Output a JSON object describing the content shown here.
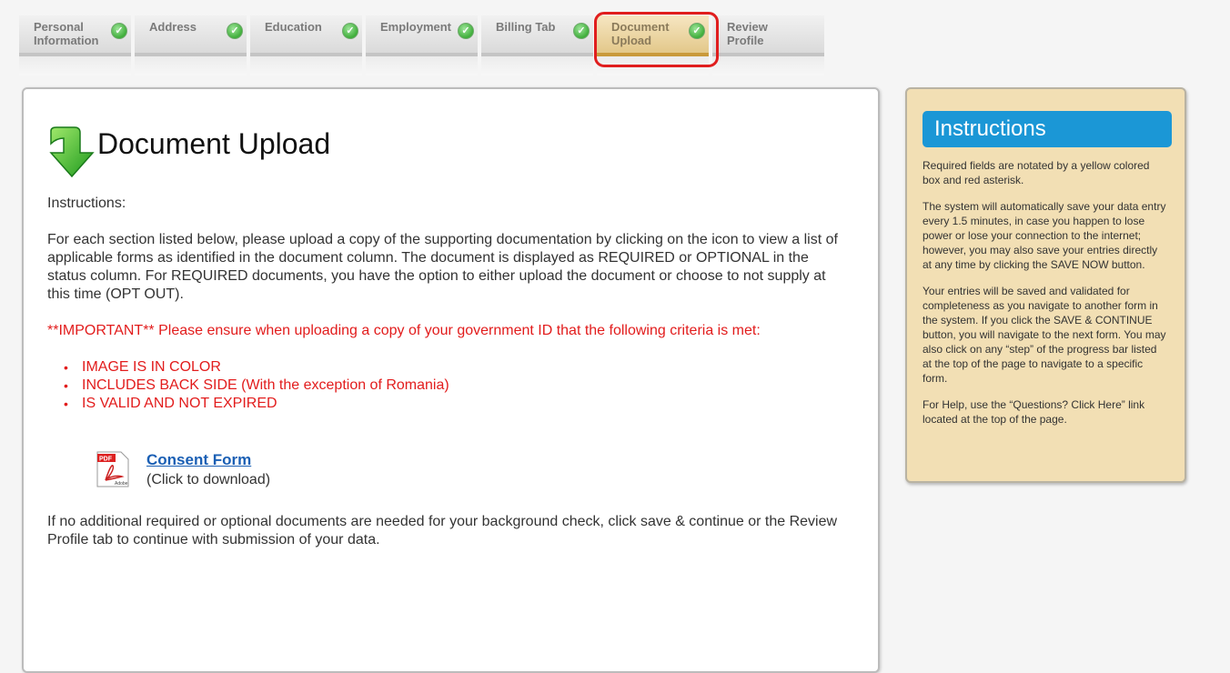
{
  "tabs": [
    {
      "label": "Personal Information",
      "completed": true,
      "active": false
    },
    {
      "label": "Address",
      "completed": true,
      "active": false
    },
    {
      "label": "Education",
      "completed": true,
      "active": false
    },
    {
      "label": "Employment",
      "completed": true,
      "active": false
    },
    {
      "label": "Billing Tab",
      "completed": true,
      "active": false
    },
    {
      "label": "Document Upload",
      "completed": true,
      "active": true
    },
    {
      "label": "Review Profile",
      "completed": false,
      "active": false
    }
  ],
  "page": {
    "title": "Document Upload",
    "instructions_label": "Instructions:",
    "instructions_text": "For each section listed below, please upload a copy of the supporting documentation by clicking on the icon to view a list of applicable forms as identified in the document column. The document is displayed as REQUIRED or OPTIONAL in the status column. For REQUIRED documents, you have the option to either upload the document or choose to not supply at this time (OPT OUT).",
    "important": "**IMPORTANT** Please ensure when uploading a copy of your government ID that the following criteria is met:",
    "criteria": [
      "IMAGE IS IN COLOR",
      "INCLUDES BACK SIDE (With the exception of Romania)",
      "IS VALID AND NOT EXPIRED"
    ],
    "consent_link": "Consent Form",
    "consent_sub": "(Click to download)",
    "pdf_icon_text": "PDF",
    "pdf_icon_brand": "Adobe",
    "footer": "If no additional required or optional documents are needed for your background check, click save & continue or the Review Profile tab to continue with submission of your data."
  },
  "side": {
    "title": "Instructions",
    "paragraphs": [
      "Required fields are notated by a yellow colored box and red asterisk.",
      "The system will automatically save your data entry every 1.5 minutes, in case you happen to lose power or lose your connection to the internet; however, you may also save your entries directly at any time by clicking the SAVE NOW button.",
      "Your entries will be saved and validated for completeness as you navigate to another form in the system. If you click the SAVE & CONTINUE button, you will navigate to the next form. You may also click on any “step” of the progress bar listed at the top of the page to navigate to a specific form.",
      "For Help, use the “Questions? Click Here” link located at the top of the page."
    ]
  },
  "colors": {
    "accent_blue": "#1b97d6",
    "important_red": "#e21c1c",
    "active_tab": "#e3c88a",
    "side_panel": "#f2dfb4"
  }
}
